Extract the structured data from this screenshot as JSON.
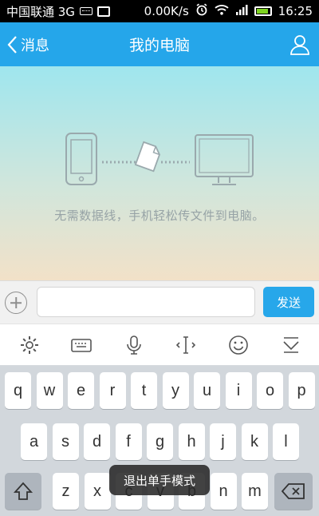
{
  "status_bar": {
    "carrier": "中国联通 3G",
    "speed": "0.00K/s",
    "time": "16:25",
    "icons": [
      "keyboard-icon",
      "image-icon",
      "alarm-icon",
      "wifi-icon",
      "signal-icon",
      "battery-icon"
    ]
  },
  "header": {
    "back_label": "消息",
    "title": "我的电脑",
    "profile_icon": "profile-icon"
  },
  "main": {
    "hint": "无需数据线，手机轻松传文件到电脑。",
    "illustration_icons": [
      "phone-icon",
      "file-icon",
      "monitor-icon"
    ]
  },
  "input_bar": {
    "message_value": "",
    "message_placeholder": "",
    "send_label": "发送"
  },
  "keyboard_toolbar": {
    "tools": [
      "settings-icon",
      "keyboard-icon",
      "microphone-icon",
      "cursor-icon",
      "emoji-icon",
      "hide-keyboard-icon"
    ]
  },
  "keyboard": {
    "row1": [
      "q",
      "w",
      "e",
      "r",
      "t",
      "y",
      "u",
      "i",
      "o",
      "p"
    ],
    "row2": [
      "a",
      "s",
      "d",
      "f",
      "g",
      "h",
      "j",
      "k",
      "l"
    ],
    "row3": [
      "z",
      "x",
      "c",
      "v",
      "b",
      "n",
      "m"
    ],
    "shift_icon": "shift-icon",
    "backspace_icon": "backspace-icon"
  },
  "toast": {
    "text": "退出单手模式"
  },
  "colors": {
    "accent": "#25a6ea",
    "send_button": "#27a7ea",
    "keyboard_bg": "#d2d7dc",
    "battery_fill": "#7ed321"
  }
}
